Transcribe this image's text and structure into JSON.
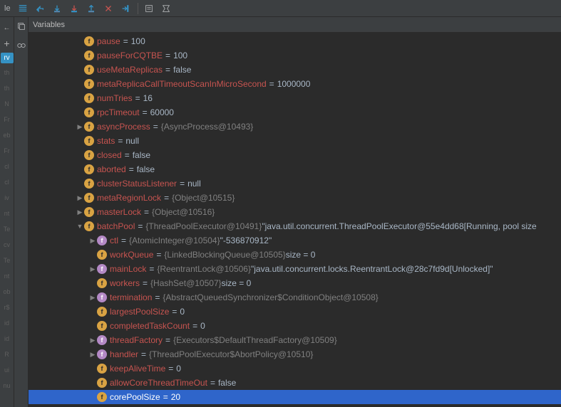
{
  "toolbar_label": "le",
  "variables_label": "Variables",
  "side_tabs": [
    "rv",
    "th",
    "th",
    "N",
    "Fr",
    "eb",
    "Fr",
    "cl",
    "cl",
    "iv",
    "nt",
    "Te",
    "cv",
    "Te",
    "nt",
    "ob",
    "r$",
    "id",
    "id",
    "R",
    "ui",
    "nu"
  ],
  "tree": [
    {
      "indent": 2,
      "arrow": "none",
      "badge": "f",
      "name": "pause",
      "eq": "=",
      "val": "100",
      "cls": "val"
    },
    {
      "indent": 2,
      "arrow": "none",
      "badge": "f",
      "name": "pauseForCQTBE",
      "eq": "=",
      "val": "100",
      "cls": "val"
    },
    {
      "indent": 2,
      "arrow": "none",
      "badge": "f",
      "name": "useMetaReplicas",
      "eq": "=",
      "val": "false",
      "cls": "val"
    },
    {
      "indent": 2,
      "arrow": "none",
      "badge": "f",
      "name": "metaReplicaCallTimeoutScanInMicroSecond",
      "eq": "=",
      "val": "1000000",
      "cls": "val"
    },
    {
      "indent": 2,
      "arrow": "none",
      "badge": "f",
      "name": "numTries",
      "eq": "=",
      "val": "16",
      "cls": "val"
    },
    {
      "indent": 2,
      "arrow": "none",
      "badge": "f",
      "name": "rpcTimeout",
      "eq": "=",
      "val": "60000",
      "cls": "val"
    },
    {
      "indent": 2,
      "arrow": "right",
      "badge": "f",
      "name": "asyncProcess",
      "eq": "=",
      "gray": "{AsyncProcess@10493}"
    },
    {
      "indent": 2,
      "arrow": "none",
      "badge": "f",
      "name": "stats",
      "eq": "=",
      "val": "null",
      "cls": "val"
    },
    {
      "indent": 2,
      "arrow": "none",
      "badge": "f",
      "name": "closed",
      "eq": "=",
      "val": "false",
      "cls": "val"
    },
    {
      "indent": 2,
      "arrow": "none",
      "badge": "f",
      "name": "aborted",
      "eq": "=",
      "val": "false",
      "cls": "val"
    },
    {
      "indent": 2,
      "arrow": "none",
      "badge": "f",
      "name": "clusterStatusListener",
      "eq": "=",
      "val": "null",
      "cls": "val"
    },
    {
      "indent": 2,
      "arrow": "right",
      "badge": "f",
      "name": "metaRegionLock",
      "eq": "=",
      "gray": "{Object@10515}"
    },
    {
      "indent": 2,
      "arrow": "right",
      "badge": "f",
      "name": "masterLock",
      "eq": "=",
      "gray": "{Object@10516}"
    },
    {
      "indent": 2,
      "arrow": "down",
      "badge": "f",
      "name": "batchPool",
      "eq": "=",
      "gray": "{ThreadPoolExecutor@10491}",
      "str": " \"java.util.concurrent.ThreadPoolExecutor@55e4dd68[Running, pool size"
    },
    {
      "indent": 3,
      "arrow": "right",
      "badge": "purple",
      "name": "ctl",
      "eq": "=",
      "gray": "{AtomicInteger@10504}",
      "str": " \"-536870912\""
    },
    {
      "indent": 3,
      "arrow": "none",
      "badge": "f",
      "name": "workQueue",
      "eq": "=",
      "gray": "{LinkedBlockingQueue@10505}",
      "extra": "  size = 0"
    },
    {
      "indent": 3,
      "arrow": "right",
      "badge": "purple",
      "name": "mainLock",
      "eq": "=",
      "gray": "{ReentrantLock@10506}",
      "str": " \"java.util.concurrent.locks.ReentrantLock@28c7fd9d[Unlocked]\""
    },
    {
      "indent": 3,
      "arrow": "none",
      "badge": "f",
      "name": "workers",
      "eq": "=",
      "gray": "{HashSet@10507}",
      "extra": "  size = 0"
    },
    {
      "indent": 3,
      "arrow": "right",
      "badge": "purple",
      "name": "termination",
      "eq": "=",
      "gray": "{AbstractQueuedSynchronizer$ConditionObject@10508}"
    },
    {
      "indent": 3,
      "arrow": "none",
      "badge": "f",
      "name": "largestPoolSize",
      "eq": "=",
      "val": "0",
      "cls": "val"
    },
    {
      "indent": 3,
      "arrow": "none",
      "badge": "f",
      "name": "completedTaskCount",
      "eq": "=",
      "val": "0",
      "cls": "val"
    },
    {
      "indent": 3,
      "arrow": "right",
      "badge": "purple",
      "name": "threadFactory",
      "eq": "=",
      "gray": "{Executors$DefaultThreadFactory@10509}"
    },
    {
      "indent": 3,
      "arrow": "right",
      "badge": "purple",
      "name": "handler",
      "eq": "=",
      "gray": "{ThreadPoolExecutor$AbortPolicy@10510}"
    },
    {
      "indent": 3,
      "arrow": "none",
      "badge": "f",
      "name": "keepAliveTime",
      "eq": "=",
      "val": "0",
      "cls": "val"
    },
    {
      "indent": 3,
      "arrow": "none",
      "badge": "f",
      "name": "allowCoreThreadTimeOut",
      "eq": "=",
      "val": "false",
      "cls": "val"
    },
    {
      "indent": 3,
      "arrow": "none",
      "badge": "f",
      "name": "corePoolSize",
      "eq": "=",
      "val": "20",
      "cls": "val",
      "selected": true
    }
  ]
}
